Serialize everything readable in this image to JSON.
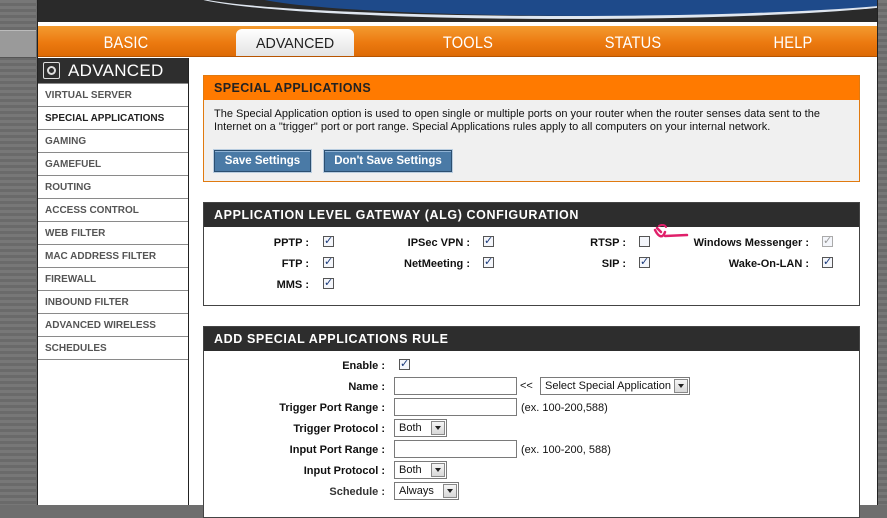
{
  "nav": {
    "tabs": [
      {
        "label": "BASIC"
      },
      {
        "label": "ADVANCED"
      },
      {
        "label": "TOOLS"
      },
      {
        "label": "STATUS"
      },
      {
        "label": "HELP"
      }
    ],
    "active": "ADVANCED"
  },
  "sidebar": {
    "title": "ADVANCED",
    "items": [
      {
        "label": "VIRTUAL SERVER"
      },
      {
        "label": "SPECIAL APPLICATIONS"
      },
      {
        "label": "GAMING"
      },
      {
        "label": "GAMEFUEL"
      },
      {
        "label": "ROUTING"
      },
      {
        "label": "ACCESS CONTROL"
      },
      {
        "label": "WEB FILTER"
      },
      {
        "label": "MAC ADDRESS FILTER"
      },
      {
        "label": "FIREWALL"
      },
      {
        "label": "INBOUND FILTER"
      },
      {
        "label": "ADVANCED WIRELESS"
      },
      {
        "label": "SCHEDULES"
      }
    ],
    "active_item": "SPECIAL APPLICATIONS"
  },
  "special_apps": {
    "title": "SPECIAL APPLICATIONS",
    "description": "The Special Application option is used to open single or multiple ports on your router when the router senses data sent to the Internet on a \"trigger\" port or port range. Special Applications rules apply to all computers on your internal network.",
    "save_label": "Save Settings",
    "dont_save_label": "Don't Save Settings"
  },
  "alg": {
    "title": "APPLICATION LEVEL GATEWAY (ALG) CONFIGURATION",
    "items": [
      {
        "label": "PPTP :",
        "checked": true
      },
      {
        "label": "IPSec VPN :",
        "checked": true
      },
      {
        "label": "RTSP :",
        "checked": false
      },
      {
        "label": "Windows Messenger :",
        "checked": true,
        "disabled": true
      },
      {
        "label": "FTP :",
        "checked": true
      },
      {
        "label": "NetMeeting :",
        "checked": true
      },
      {
        "label": "SIP :",
        "checked": true
      },
      {
        "label": "Wake-On-LAN :",
        "checked": true
      },
      {
        "label": "MMS :",
        "checked": true
      }
    ]
  },
  "rule": {
    "title": "ADD SPECIAL APPLICATIONS RULE",
    "enable_label": "Enable :",
    "enable_checked": true,
    "name_label": "Name :",
    "name_value": "",
    "name_arrow": "<<",
    "app_select": "Select Special Application",
    "trigger_range_label": "Trigger Port Range :",
    "trigger_range_value": "",
    "trigger_range_hint": "(ex. 100-200,588)",
    "trigger_protocol_label": "Trigger Protocol :",
    "trigger_protocol_value": "Both",
    "input_range_label": "Input Port Range :",
    "input_range_value": "",
    "input_range_hint": "(ex. 100-200, 588)",
    "input_protocol_label": "Input Protocol :",
    "input_protocol_value": "Both",
    "schedule_label": "Schedule :",
    "schedule_value": "Always"
  },
  "colors": {
    "nav_orange": "#ee7d12",
    "header_dark": "#2d2d2d",
    "button_blue": "#4a7aa6",
    "annotation_pink": "#e0206a"
  }
}
